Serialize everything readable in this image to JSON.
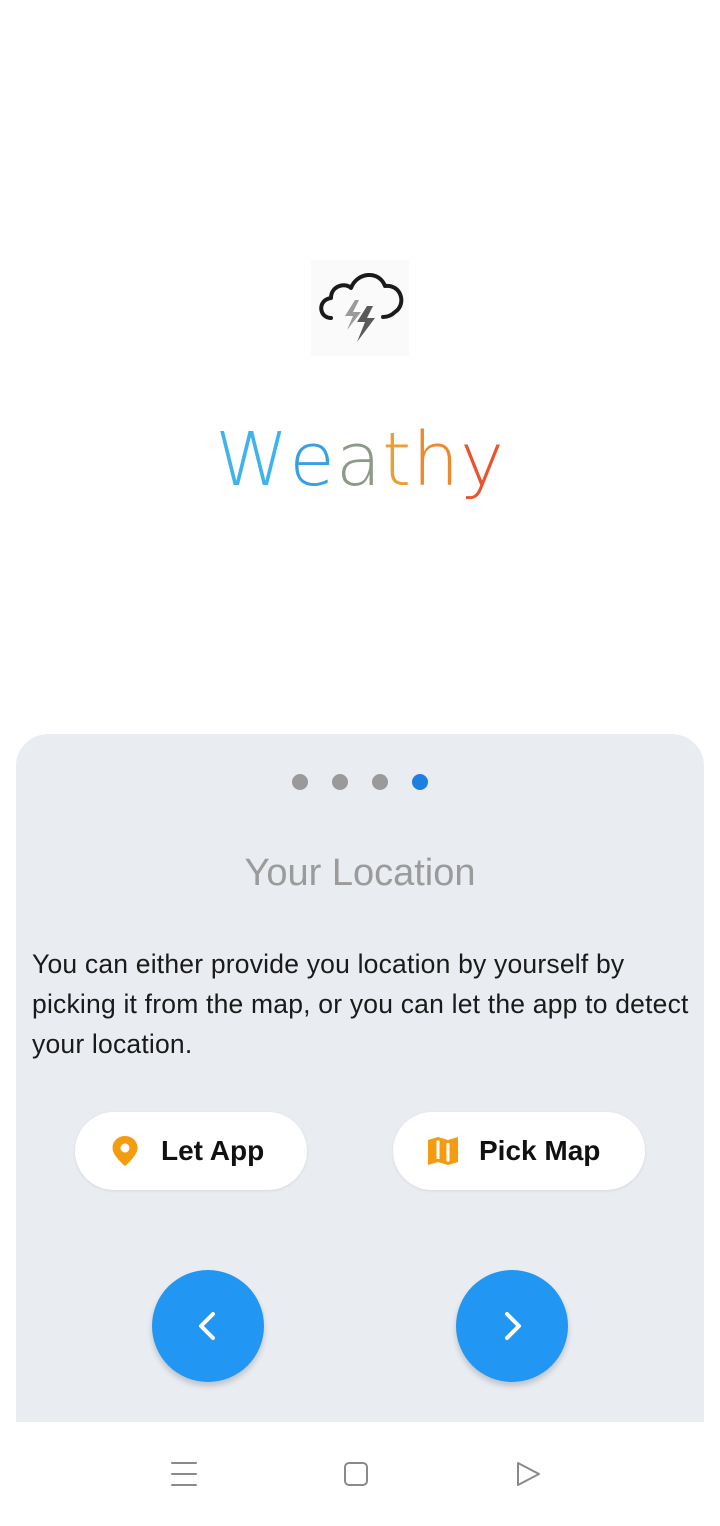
{
  "app": {
    "title_letters": [
      "W",
      "e",
      "a",
      "t",
      "h",
      "y"
    ],
    "title_colors": [
      "#3fb3ea",
      "#3a9fe0",
      "#5a8fc6",
      "#a3987a",
      "#e9a02e",
      "#e8552e"
    ]
  },
  "logo": {
    "icon": "cloud-lightning-icon"
  },
  "onboarding": {
    "pages_total": 4,
    "active_page": 4,
    "title": "Your Location",
    "description": "You can either provide you location by yourself by picking it from the map, or you can let the app to detect your location.",
    "let_app_button": {
      "label": "Let App",
      "icon": "location-pin-icon",
      "icon_color": "#f39c12"
    },
    "pick_map_button": {
      "label": "Pick Map",
      "icon": "map-icon",
      "icon_color": "#f39c12"
    },
    "prev_button": {
      "icon": "chevron-left-icon"
    },
    "next_button": {
      "icon": "chevron-right-icon"
    },
    "accent_color": "#2196f3",
    "card_color": "#e9ecf1"
  },
  "system_nav": {
    "menu_icon": "menu-icon",
    "home_icon": "home-square-icon",
    "back_icon": "back-triangle-icon"
  }
}
